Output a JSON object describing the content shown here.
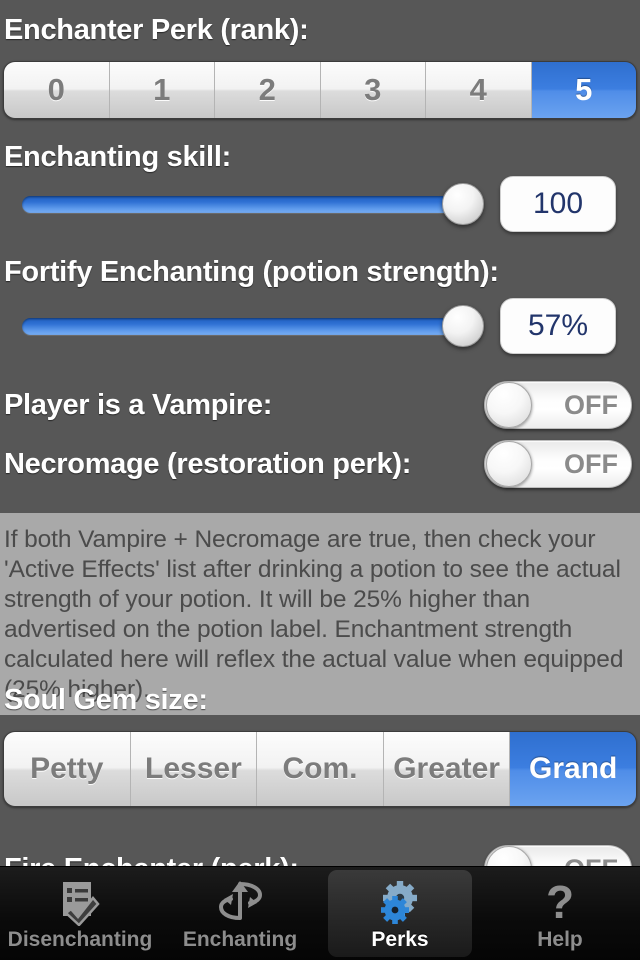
{
  "app": {
    "background_color": "#575757",
    "accent_color": "#3c7ee0",
    "info_panel_color": "#a9a9a9"
  },
  "sections": {
    "enchanter_perk": {
      "label": "Enchanter Perk (rank):",
      "options": [
        "0",
        "1",
        "2",
        "3",
        "4",
        "5"
      ],
      "selected_index": 5,
      "selected_value": "5"
    },
    "enchanting_skill": {
      "label": "Enchanting skill:",
      "value": "100",
      "slider_percent": 100
    },
    "fortify_enchanting": {
      "label": "Fortify Enchanting (potion strength):",
      "value": "57%",
      "slider_percent": 100
    },
    "vampire": {
      "label": "Player is a Vampire:",
      "toggle_state": "OFF"
    },
    "necromage": {
      "label": "Necromage (restoration perk):",
      "toggle_state": "OFF"
    },
    "info_note": {
      "text": "If both Vampire + Necromage are true, then check your 'Active Effects' list after drinking a potion to see the actual strength of your potion. It will be 25% higher than advertised on the potion label. Enchantment strength calculated here will reflex the actual value when equipped (25% higher)."
    },
    "soul_gem": {
      "label": "Soul Gem size:",
      "options": [
        "Petty",
        "Lesser",
        "Com.",
        "Greater",
        "Grand"
      ],
      "selected_index": 4,
      "selected_value": "Grand"
    },
    "fire_enchanter": {
      "label": "Fire Enchanter (perk):",
      "toggle_state": "OFF"
    }
  },
  "tabbar": {
    "items": [
      {
        "label": "Disenchanting",
        "icon": "checklist-check-icon",
        "active": false
      },
      {
        "label": "Enchanting",
        "icon": "enchant-arrow-icon",
        "active": false
      },
      {
        "label": "Perks",
        "icon": "gears-icon",
        "active": true
      },
      {
        "label": "Help",
        "icon": "question-mark-icon",
        "active": false
      }
    ]
  }
}
